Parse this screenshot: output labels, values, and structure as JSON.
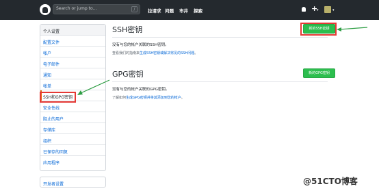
{
  "header": {
    "search_placeholder": "Search or jump to...",
    "search_key": "/",
    "nav": [
      "拉请求",
      "问题",
      "市井",
      "探索"
    ],
    "plus_label": "+",
    "caret": "▾"
  },
  "sidebar": {
    "heading": "个人设置",
    "items": [
      {
        "label": "配置文件"
      },
      {
        "label": "帐户"
      },
      {
        "label": "电子邮件"
      },
      {
        "label": "通知"
      },
      {
        "label": "帐单"
      },
      {
        "label": "SSH和GPG密钥",
        "selected": true
      },
      {
        "label": "安全性线"
      },
      {
        "label": "阻止的用户"
      },
      {
        "label": "存储库"
      },
      {
        "label": "组织"
      },
      {
        "label": "已保存的回复"
      },
      {
        "label": "应用程序"
      }
    ],
    "developer_settings": "开发者设置"
  },
  "ssh": {
    "title": "SSH密钥",
    "button": "新的SSH密钥",
    "empty_message": "没有与您的帐户关联的SSH密钥。",
    "guide_prefix": "查看我们的指南来",
    "guide_link": "生成SSH密钥或解决常见的SSH问题",
    "guide_suffix": "。"
  },
  "gpg": {
    "title": "GPG密钥",
    "button": "新的GPG密钥",
    "empty_message": "没有与您的帐户关联的GPG密钥。",
    "guide_prefix": "了解如何",
    "guide_link": "生成GPG密钥并将其添加到您的帐户",
    "guide_suffix": "。"
  },
  "watermark": "@51CTO博客",
  "colors": {
    "header_bg": "#24292e",
    "link": "#0366d6",
    "button_green": "#2cbe4e",
    "highlight_red": "#e53935",
    "arrow_green": "#2e9e44"
  }
}
